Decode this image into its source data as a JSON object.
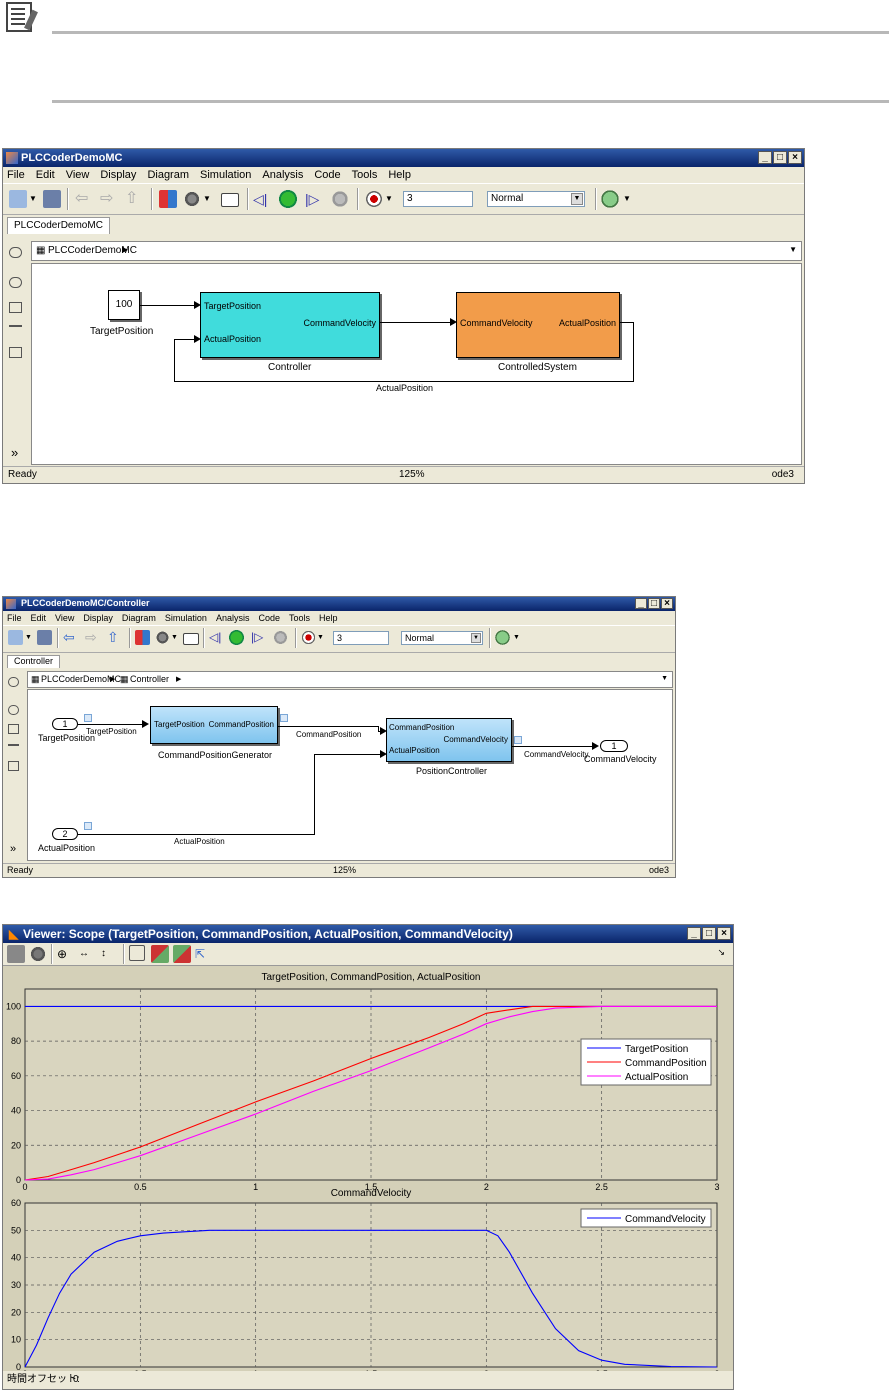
{
  "window1": {
    "title": "PLCCoderDemoMC",
    "menus": [
      "File",
      "Edit",
      "View",
      "Display",
      "Diagram",
      "Simulation",
      "Analysis",
      "Code",
      "Tools",
      "Help"
    ],
    "stop_time": "3",
    "sim_mode": "Normal",
    "tab": "PLCCoderDemoMC",
    "breadcrumb": "PLCCoderDemoMC",
    "blocks": {
      "constant_value": "100",
      "constant_label": "TargetPosition",
      "controller": {
        "in1": "TargetPosition",
        "in2": "ActualPosition",
        "out": "CommandVelocity",
        "label": "Controller"
      },
      "plant": {
        "in": "CommandVelocity",
        "out": "ActualPosition",
        "label": "ControlledSystem"
      },
      "feedback_label": "ActualPosition"
    },
    "status": {
      "left": "Ready",
      "zoom": "125%",
      "solver": "ode3"
    }
  },
  "window2": {
    "title": "PLCCoderDemoMC/Controller",
    "menus": [
      "File",
      "Edit",
      "View",
      "Display",
      "Diagram",
      "Simulation",
      "Analysis",
      "Code",
      "Tools",
      "Help"
    ],
    "stop_time": "3",
    "sim_mode": "Normal",
    "tab": "Controller",
    "breadcrumb1": "PLCCoderDemoMC",
    "breadcrumb2": "Controller",
    "blocks": {
      "in1_num": "1",
      "in1_label": "TargetPosition",
      "sig1": "TargetPosition",
      "in2_num": "2",
      "in2_label": "ActualPosition",
      "sig2": "ActualPosition",
      "gen": {
        "in": "TargetPosition",
        "out": "CommandPosition",
        "label": "CommandPositionGenerator"
      },
      "sig3": "CommandPosition",
      "pc": {
        "in1": "CommandPosition",
        "in2": "ActualPosition",
        "out": "CommandVelocity",
        "label": "PositionController"
      },
      "sig4": "CommandVelocity",
      "out1_num": "1",
      "out1_label": "CommandVelocity"
    },
    "status": {
      "left": "Ready",
      "zoom": "125%",
      "solver": "ode3"
    }
  },
  "scope": {
    "title": "Viewer: Scope (TargetPosition, CommandPosition, ActualPosition, CommandVelocity)",
    "time_offset_label": "時間オフセット:",
    "time_offset_value": "0"
  },
  "colors": {
    "target": "#0000ff",
    "command": "#ff0000",
    "actual": "#ff00ff",
    "velocity": "#0000ff",
    "cyan": "#40dcdc",
    "orange": "#f29c4a",
    "blue": "#7fc4ee"
  },
  "chart_data": [
    {
      "type": "line",
      "title": "TargetPosition, CommandPosition, ActualPosition",
      "xlim": [
        0,
        3
      ],
      "ylim": [
        0,
        110
      ],
      "xticks": [
        "0",
        "0.5",
        "1",
        "1.5",
        "2",
        "2.5",
        "3"
      ],
      "yticks": [
        "0",
        "20",
        "40",
        "60",
        "80",
        "100"
      ],
      "grid": true,
      "legend": "right",
      "x": [
        0,
        0.1,
        0.2,
        0.3,
        0.5,
        0.75,
        1.0,
        1.25,
        1.5,
        1.75,
        1.9,
        2.0,
        2.1,
        2.2,
        2.3,
        2.5,
        3.0
      ],
      "series": [
        {
          "name": "TargetPosition",
          "values": [
            100,
            100,
            100,
            100,
            100,
            100,
            100,
            100,
            100,
            100,
            100,
            100,
            100,
            100,
            100,
            100,
            100
          ]
        },
        {
          "name": "CommandPosition",
          "values": [
            0,
            2,
            6,
            10,
            19,
            32,
            45,
            57,
            70,
            82,
            90,
            96,
            98,
            100,
            100,
            100,
            100
          ]
        },
        {
          "name": "ActualPosition",
          "values": [
            0,
            0.5,
            3,
            6,
            14,
            26,
            38,
            51,
            63,
            76,
            84,
            90,
            94,
            97,
            99,
            100,
            100
          ]
        }
      ]
    },
    {
      "type": "line",
      "title": "CommandVelocity",
      "xlim": [
        0,
        3
      ],
      "ylim": [
        0,
        60
      ],
      "xticks": [
        "0",
        "0.5",
        "1",
        "1.5",
        "2",
        "2.5",
        "3"
      ],
      "yticks": [
        "0",
        "10",
        "20",
        "30",
        "40",
        "50",
        "60"
      ],
      "grid": true,
      "legend": "top-right",
      "x": [
        0,
        0.05,
        0.1,
        0.15,
        0.2,
        0.3,
        0.4,
        0.5,
        0.6,
        0.8,
        1.0,
        1.5,
        2.0,
        2.05,
        2.1,
        2.2,
        2.3,
        2.4,
        2.5,
        2.6,
        2.8,
        3.0
      ],
      "series": [
        {
          "name": "CommandVelocity",
          "values": [
            0,
            8,
            18,
            27,
            34,
            42,
            46,
            48,
            49,
            50,
            50,
            50,
            50,
            48,
            42,
            27,
            14,
            6,
            2.5,
            1,
            0.2,
            0
          ]
        }
      ]
    }
  ]
}
